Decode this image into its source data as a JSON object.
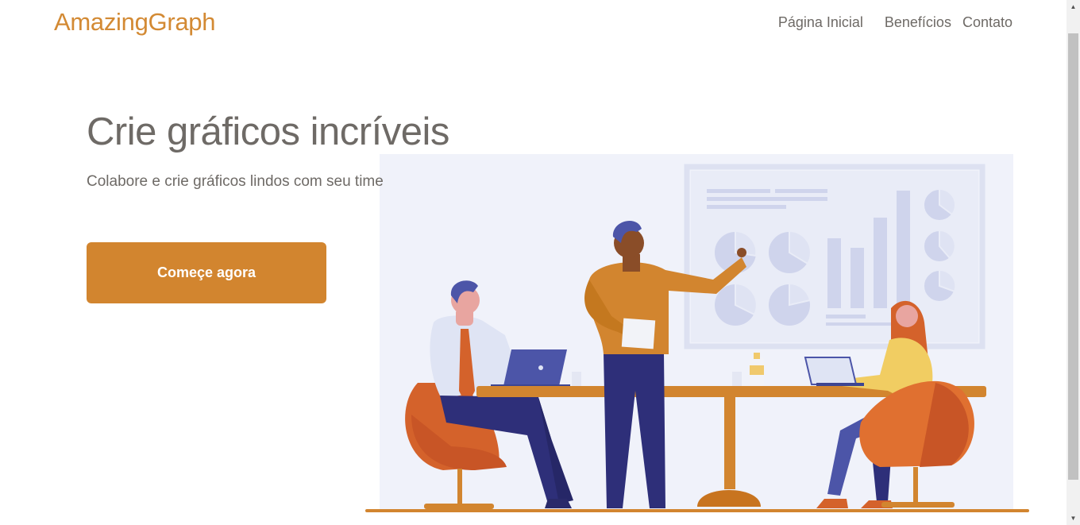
{
  "header": {
    "brand": "AmazingGraph",
    "nav": {
      "home": "Página Inicial",
      "benefits": "Benefícios",
      "contact": "Contato"
    }
  },
  "hero": {
    "title": "Crie gráficos incríveis",
    "subtitle": "Colabore e crie gráficos lindos com seu time",
    "cta_label": "Começe agora"
  },
  "colors": {
    "brand": "#d38a34",
    "button": "#d2852f",
    "text": "#6e6a66",
    "illustration_bg": "#f0f2fa"
  },
  "illustration": {
    "subject": "team-meeting-presentation"
  },
  "scrollbar": {
    "up_icon": "▲",
    "down_icon": "▼"
  }
}
